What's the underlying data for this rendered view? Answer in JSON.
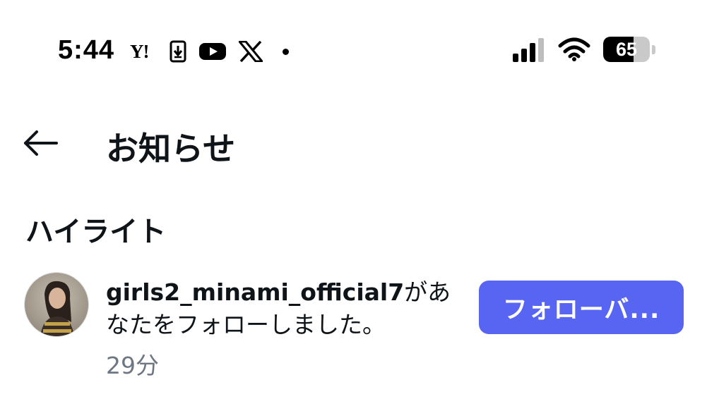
{
  "status_bar": {
    "time": "5:44",
    "yahoo_label": "Y!",
    "battery_percent": "65",
    "battery_level": 0.65,
    "icons_left": [
      "yahoo-icon",
      "download-icon",
      "youtube-icon",
      "x-icon",
      "dot-icon"
    ],
    "icons_right": [
      "signal-icon",
      "wifi-icon",
      "battery-icon"
    ]
  },
  "header": {
    "back_icon": "back-arrow-icon",
    "title": "お知らせ"
  },
  "section": {
    "title": "ハイライト"
  },
  "notification": {
    "username": "girls2_minami_official7",
    "message_after_username": "があなたをフォローしました。",
    "time": "29分",
    "follow_button_label": "フォローバ...",
    "accent_color": "#5865f2"
  }
}
